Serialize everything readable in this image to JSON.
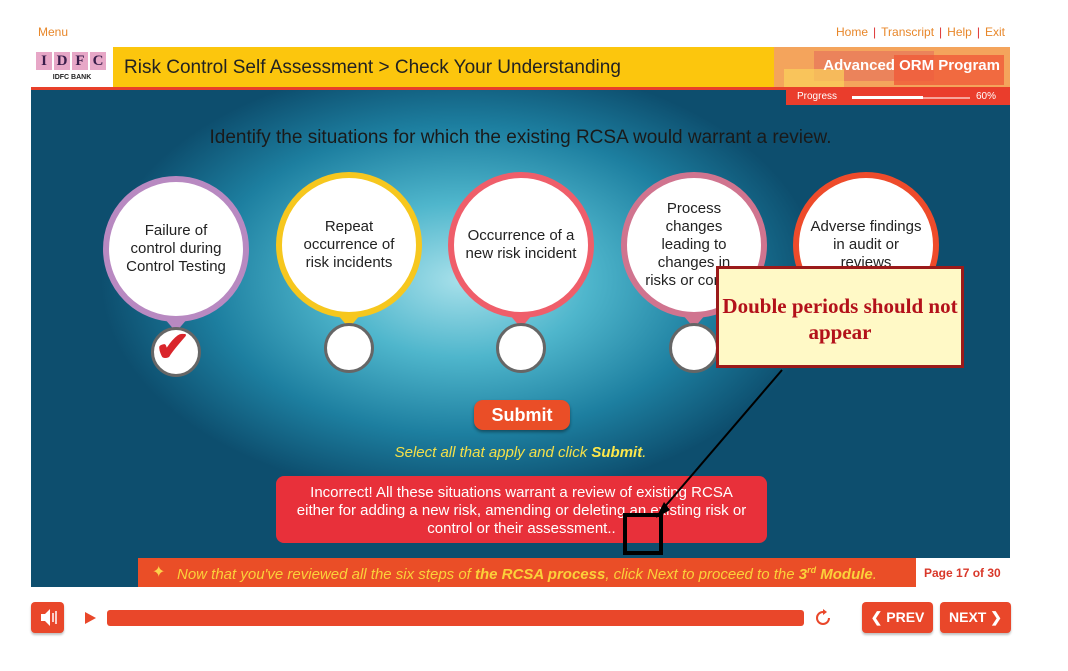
{
  "menu_label": "Menu",
  "top_links": [
    "Home",
    "Transcript",
    "Help",
    "Exit"
  ],
  "logo": {
    "letters": [
      "I",
      "D",
      "F",
      "C"
    ],
    "subtitle": "IDFC BANK"
  },
  "header": {
    "title": "Risk Control Self Assessment > Check Your Understanding",
    "program": "Advanced ORM Program"
  },
  "progress": {
    "label": "Progress",
    "value_percent": 60,
    "text": "60%"
  },
  "question": "Identify the situations for which the existing RCSA would warrant a review.",
  "options": [
    {
      "label": "Failure of control during Control Testing",
      "checked": true,
      "color": "#b889c1"
    },
    {
      "label": "Repeat occurrence of risk incidents",
      "checked": false,
      "color": "#f6c71e"
    },
    {
      "label": "Occurrence of a new risk incident",
      "checked": false,
      "color": "#ef5e6a"
    },
    {
      "label": "Process changes leading to changes in risks or control",
      "checked": false,
      "color": "#d0748f"
    },
    {
      "label": "Adverse findings in audit or reviews",
      "checked": false,
      "color": "#ee4b2b"
    }
  ],
  "submit_label": "Submit",
  "instruction": {
    "prefix": "Select all that apply and click ",
    "bold": "Submit",
    "suffix": "."
  },
  "feedback": "Incorrect! All these situations warrant a review of existing RCSA either for adding a new risk, amending or deleting an existing risk or control or their assessment..",
  "callout": "Double periods should not appear",
  "banner": {
    "part1": "Now that you've reviewed all the six steps of ",
    "bold1": "the RCSA process",
    "part2": ", click Next to proceed to the ",
    "bold2": "3",
    "sup": "rd",
    "bold3": " Module",
    "end": "."
  },
  "page": {
    "prefix": "Page ",
    "current": "17",
    "sep": " of ",
    "total": "30"
  },
  "controls": {
    "prev": "PREV",
    "next": "NEXT"
  },
  "colors": {
    "accent": "#e9472a",
    "header": "#fcc60d"
  }
}
